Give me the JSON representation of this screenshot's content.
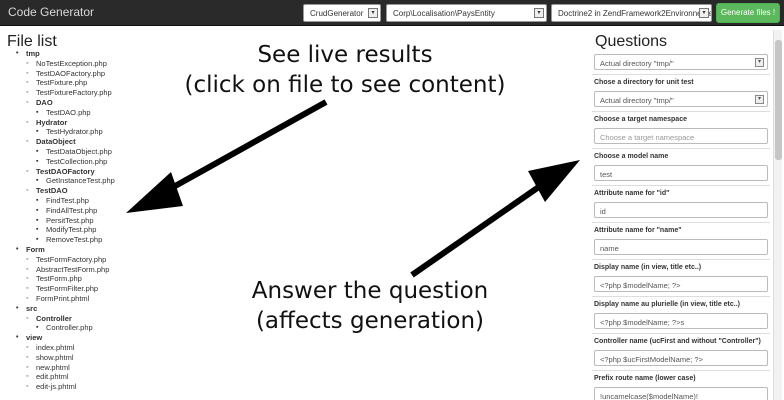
{
  "app": {
    "brand": "Code Generator",
    "selects": [
      "CrudGenerator",
      "Corp\\Localisation\\PaysEntity",
      "Doctrine2 in ZendFramework2Environnement"
    ],
    "generate_label": "Generate files !"
  },
  "filelist": {
    "title": "File list",
    "tree": [
      {
        "level": 1,
        "text": "tmp",
        "folder": true
      },
      {
        "level": 2,
        "text": "NoTestException.php"
      },
      {
        "level": 2,
        "text": "TestDAOFactory.php"
      },
      {
        "level": 2,
        "text": "TestFixture.php"
      },
      {
        "level": 2,
        "text": "TestFixtureFactory.php"
      },
      {
        "level": 2,
        "text": "DAO",
        "folder": true
      },
      {
        "level": 3,
        "text": "TestDAO.php"
      },
      {
        "level": 2,
        "text": "Hydrator",
        "folder": true
      },
      {
        "level": 3,
        "text": "TestHydrator.php"
      },
      {
        "level": 2,
        "text": "DataObject",
        "folder": true
      },
      {
        "level": 3,
        "text": "TestDataObject.php"
      },
      {
        "level": 3,
        "text": "TestCollection.php"
      },
      {
        "level": 2,
        "text": "TestDAOFactory",
        "folder": true
      },
      {
        "level": 3,
        "text": "GetInstanceTest.php"
      },
      {
        "level": 2,
        "text": "TestDAO",
        "folder": true
      },
      {
        "level": 3,
        "text": "FindTest.php"
      },
      {
        "level": 3,
        "text": "FindAllTest.php"
      },
      {
        "level": 3,
        "text": "PersitTest.php"
      },
      {
        "level": 3,
        "text": "ModifyTest.php"
      },
      {
        "level": 3,
        "text": "RemoveTest.php"
      },
      {
        "level": 1,
        "text": "Form",
        "folder": true
      },
      {
        "level": 2,
        "text": "TestFormFactory.php"
      },
      {
        "level": 2,
        "text": "AbstractTestForm.php"
      },
      {
        "level": 2,
        "text": "TestForm.php"
      },
      {
        "level": 2,
        "text": "TestFormFilter.php"
      },
      {
        "level": 2,
        "text": "FormPrint.phtml"
      },
      {
        "level": 1,
        "text": "src",
        "folder": true
      },
      {
        "level": 2,
        "text": "Controller",
        "folder": true
      },
      {
        "level": 3,
        "text": "Controller.php"
      },
      {
        "level": 1,
        "text": "view",
        "folder": true
      },
      {
        "level": 2,
        "text": "index.phtml"
      },
      {
        "level": 2,
        "text": "show.phtml"
      },
      {
        "level": 2,
        "text": "new.phtml"
      },
      {
        "level": 2,
        "text": "edit.phtml"
      },
      {
        "level": 2,
        "text": "edit-js.phtml"
      }
    ]
  },
  "questions": {
    "title": "Questions",
    "items": [
      {
        "label": "",
        "value": "Actual directory \"tmp/\"",
        "type": "select"
      },
      {
        "label": "Chose a directory for unit test",
        "value": "Actual directory \"tmp/\"",
        "type": "select"
      },
      {
        "label": "Choose a target namespace",
        "value": "",
        "placeholder": "Choose a target namespace",
        "type": "text"
      },
      {
        "label": "Choose a model name",
        "value": "test",
        "type": "text"
      },
      {
        "label": "Attribute name for \"id\"",
        "value": "id",
        "type": "text"
      },
      {
        "label": "Attribute name for \"name\"",
        "value": "name",
        "type": "text"
      },
      {
        "label": "Display name (in view, title etc..)",
        "value": "<?php $modelName; ?>",
        "type": "text"
      },
      {
        "label": "Display name au plurielle (in view, title etc..)",
        "value": "<?php $modelName; ?>s",
        "type": "text"
      },
      {
        "label": "Controller name (ucFirst and without \"Controller\")",
        "value": "<?php $ucFirstModelName; ?>",
        "type": "text"
      },
      {
        "label": "Prefix route name (lower case)",
        "value": "!uncamelcase($modelName)!",
        "type": "text"
      }
    ]
  },
  "annotations": {
    "live_line1": "See live results",
    "live_line2": "(click on file to see content)",
    "answer_line1": "Answer the question",
    "answer_line2": "(affects generation)"
  }
}
